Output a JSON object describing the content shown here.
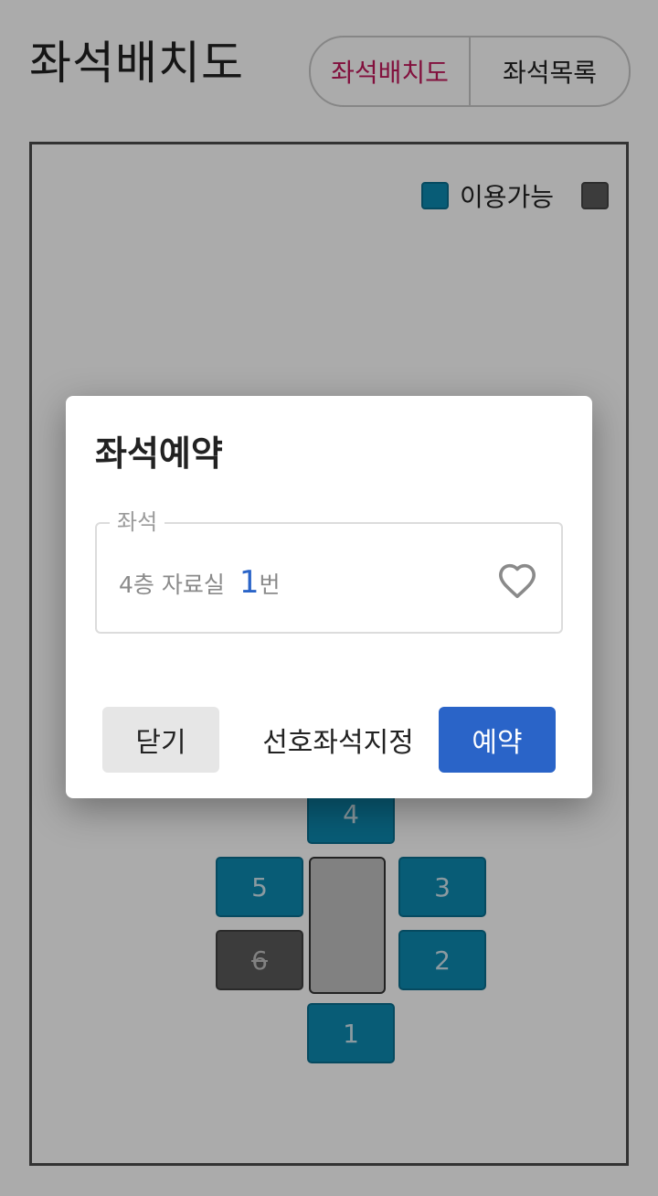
{
  "header": {
    "title": "좌석배치도",
    "tabs": [
      {
        "label": "좌석배치도",
        "active": true
      },
      {
        "label": "좌석목록",
        "active": false
      }
    ]
  },
  "legend": {
    "available_label": "이용가능",
    "available_color": "#0c8ab1",
    "used_color": "#5a5a5a"
  },
  "seats": [
    {
      "number": "4",
      "status": "available"
    },
    {
      "number": "5",
      "status": "available"
    },
    {
      "number": "3",
      "status": "available"
    },
    {
      "number": "6",
      "status": "occupied"
    },
    {
      "number": "2",
      "status": "available"
    },
    {
      "number": "1",
      "status": "available"
    }
  ],
  "dialog": {
    "title": "좌석예약",
    "field_label": "좌석",
    "seat_location": "4층 자료실",
    "seat_number": "1",
    "seat_suffix": "번",
    "favorite_icon": "heart-outline-icon",
    "buttons": {
      "close": "닫기",
      "favorite": "선호좌석지정",
      "reserve": "예약"
    },
    "accent_color": "#2a64c8"
  }
}
